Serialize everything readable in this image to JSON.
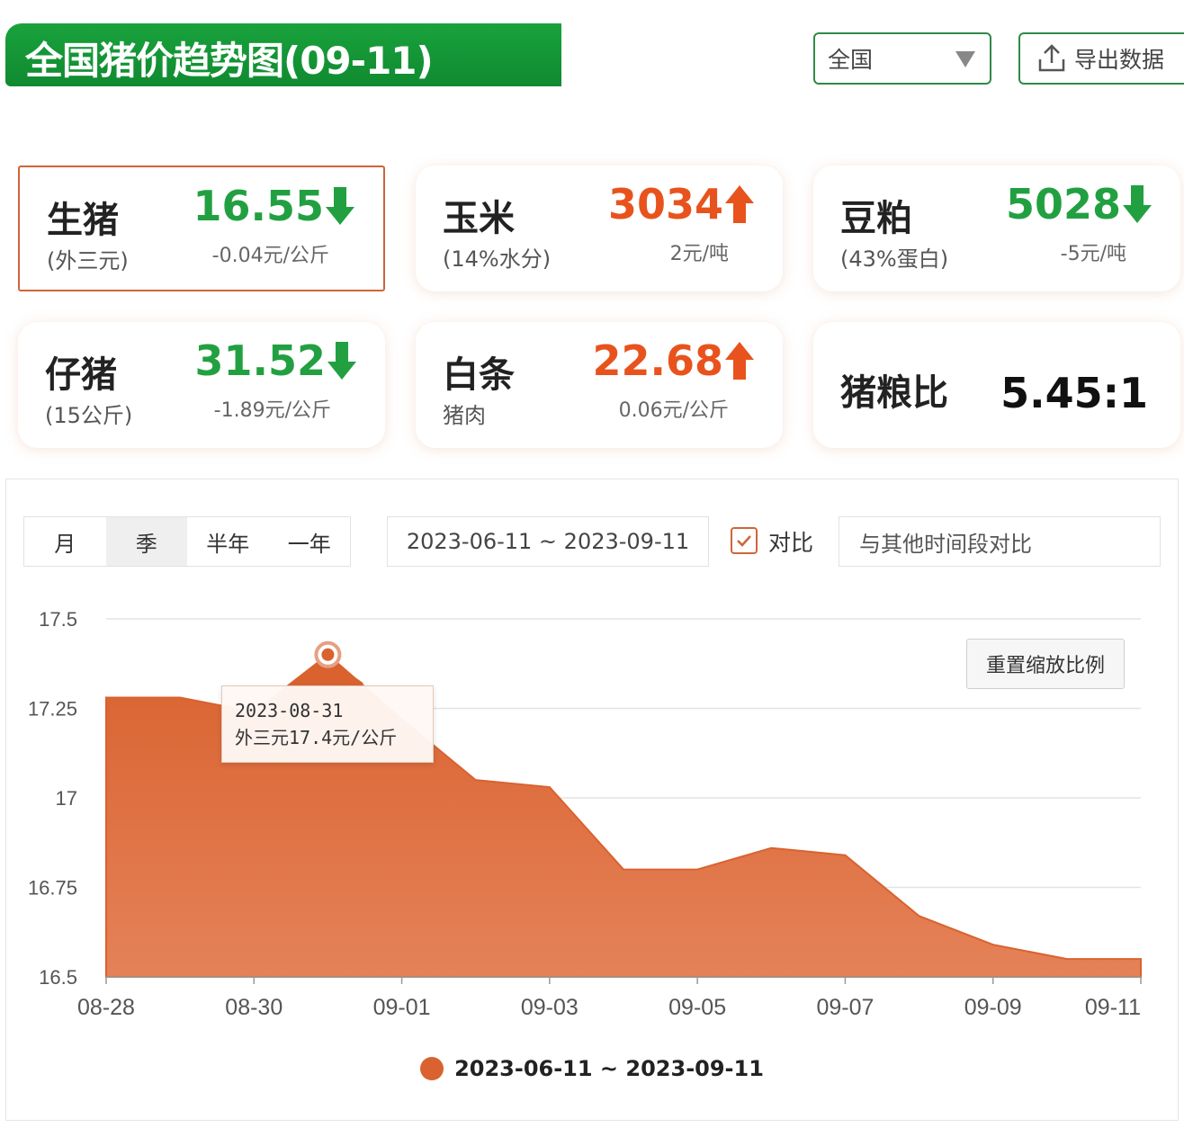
{
  "header": {
    "title": "全国猪价趋势图(09-11)",
    "region_select": "全国",
    "export_label": "导出数据"
  },
  "cards": [
    {
      "name": "生猪",
      "sub": "(外三元)",
      "value": "16.55",
      "direction": "down",
      "change": "-0.04元/公斤"
    },
    {
      "name": "玉米",
      "sub": "(14%水分)",
      "value": "3034",
      "direction": "up",
      "change": "2元/吨"
    },
    {
      "name": "豆粕",
      "sub": "(43%蛋白)",
      "value": "5028",
      "direction": "down",
      "change": "-5元/吨"
    },
    {
      "name": "仔猪",
      "sub": "(15公斤)",
      "value": "31.52",
      "direction": "down",
      "change": "-1.89元/公斤"
    },
    {
      "name": "白条",
      "sub": "猪肉",
      "value": "22.68",
      "direction": "up",
      "change": "0.06元/公斤"
    },
    {
      "name": "猪粮比",
      "value": "5.45:1"
    }
  ],
  "controls": {
    "range_tabs": [
      "月",
      "季",
      "半年",
      "一年"
    ],
    "selected_tab": "季",
    "date_range": "2023-06-11 ~ 2023-09-11",
    "compare_label": "对比",
    "compare_placeholder": "与其他时间段对比",
    "reset_zoom": "重置缩放比例"
  },
  "tooltip": {
    "date": "2023-08-31",
    "text": "外三元17.4元/公斤"
  },
  "colors": {
    "area": "#d9622f",
    "up": "#e8531d",
    "down": "#22a041",
    "brand_green": "#19a23d"
  },
  "chart_data": {
    "type": "area",
    "x": [
      "2023-08-28",
      "2023-08-29",
      "2023-08-30",
      "2023-08-31",
      "2023-09-01",
      "2023-09-02",
      "2023-09-03",
      "2023-09-04",
      "2023-09-05",
      "2023-09-06",
      "2023-09-07",
      "2023-09-08",
      "2023-09-09",
      "2023-09-10",
      "2023-09-11"
    ],
    "x_tick_labels": [
      "08-28",
      "08-30",
      "09-01",
      "09-03",
      "09-05",
      "09-07",
      "09-09",
      "09-11"
    ],
    "y_tick_labels": [
      "17.5",
      "17.25",
      "17",
      "16.75",
      "16.5"
    ],
    "y_ticks": [
      17.5,
      17.25,
      17,
      16.75,
      16.5
    ],
    "series": [
      {
        "name": "2023-06-11 ~ 2023-09-11",
        "values": [
          17.28,
          17.28,
          17.24,
          17.4,
          17.22,
          17.05,
          17.03,
          16.8,
          16.8,
          16.86,
          16.84,
          16.67,
          16.59,
          16.55,
          16.55
        ]
      }
    ],
    "ylim": [
      16.5,
      17.5
    ],
    "highlight_index": 3,
    "grid": true,
    "legend_position": "bottom-center"
  }
}
